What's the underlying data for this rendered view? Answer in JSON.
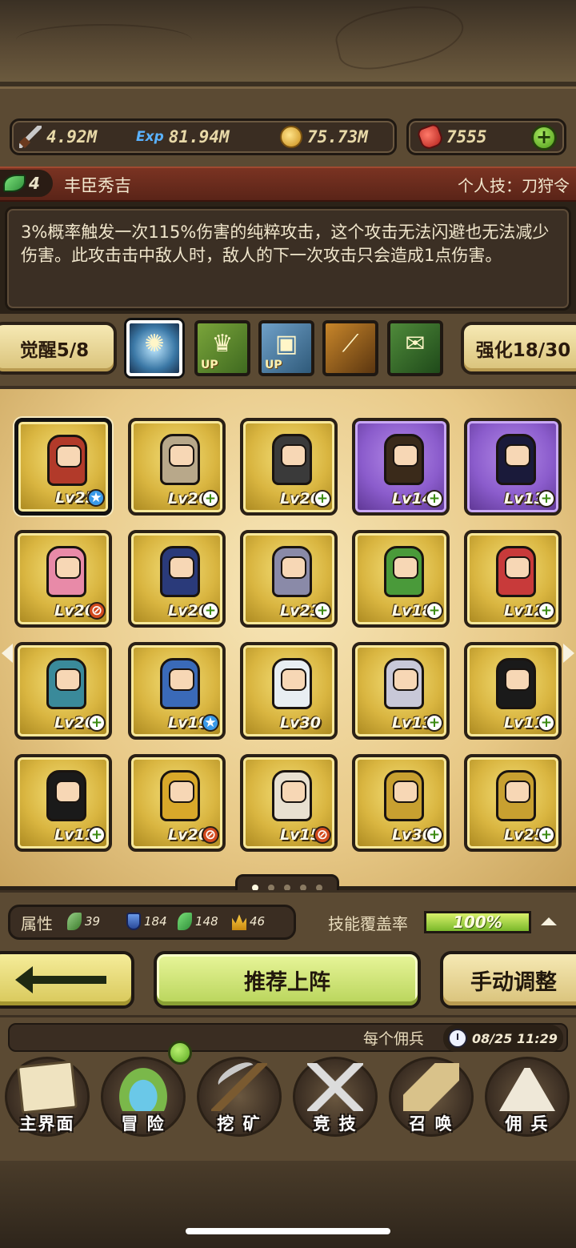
{
  "resources": {
    "attack": "4.92M",
    "exp_icon_text": "Exp",
    "exp": "81.94M",
    "gold": "75.73M",
    "gems": "7555",
    "plus_symbol": "+"
  },
  "hero": {
    "level": "4",
    "name": "丰臣秀吉",
    "skill": "个人技：刀狩令",
    "description": "3%概率触发一次115%伤害的纯粹攻击，这个攻击无法闪避也无法减少伤害。此攻击击中敌人时，敌人的下一次攻击只会造成1点伤害。"
  },
  "awaken": {
    "label": "觉醒5/8",
    "upgrade_label": "强化18/30",
    "up_text": "UP"
  },
  "heroes": [
    {
      "lv": "Lv25",
      "badge": "star",
      "sprite_color": "#b23a2a"
    },
    {
      "lv": "Lv26",
      "badge": "plus",
      "sprite_color": "#b8a88a"
    },
    {
      "lv": "Lv20",
      "badge": "plus",
      "sprite_color": "#3a3a3a"
    },
    {
      "lv": "Lv14",
      "badge": "plus",
      "sprite_color": "#3a2a1a",
      "purple": true
    },
    {
      "lv": "Lv13",
      "badge": "plus",
      "sprite_color": "#1a1a3a",
      "purple": true
    },
    {
      "lv": "Lv20",
      "badge": "no",
      "sprite_color": "#e88aa8"
    },
    {
      "lv": "Lv20",
      "badge": "plus",
      "sprite_color": "#2a3a7a"
    },
    {
      "lv": "Lv23",
      "badge": "plus",
      "sprite_color": "#8a8aa8"
    },
    {
      "lv": "Lv18",
      "badge": "plus",
      "sprite_color": "#4a9a3a"
    },
    {
      "lv": "Lv12",
      "badge": "plus",
      "sprite_color": "#c83a3a"
    },
    {
      "lv": "Lv20",
      "badge": "plus",
      "sprite_color": "#3a8a9a"
    },
    {
      "lv": "Lv19",
      "badge": "star",
      "sprite_color": "#3a6ab8"
    },
    {
      "lv": "Lv30",
      "badge": "",
      "sprite_color": "#e8eef2"
    },
    {
      "lv": "Lv13",
      "badge": "plus",
      "sprite_color": "#c8c8d8"
    },
    {
      "lv": "Lv11",
      "badge": "plus",
      "sprite_color": "#1a1a1a"
    },
    {
      "lv": "Lv11",
      "badge": "plus",
      "sprite_color": "#1a1a1a"
    },
    {
      "lv": "Lv20",
      "badge": "no",
      "sprite_color": "#d8a82a"
    },
    {
      "lv": "Lv15",
      "badge": "no",
      "sprite_color": "#e8e0d0"
    },
    {
      "lv": "Lv30",
      "badge": "plus",
      "sprite_color": "#c8a030"
    },
    {
      "lv": "Lv25",
      "badge": "plus",
      "sprite_color": "#c8a030"
    }
  ],
  "badge_symbols": {
    "plus": "+",
    "star": "★",
    "no": "⊘"
  },
  "attributes": {
    "label": "属性",
    "leaf": "39",
    "shield": "184",
    "gem": "148",
    "crown": "46",
    "coverage_label": "技能覆盖率",
    "coverage": "100%",
    "coverage_fraction": 1.0
  },
  "actions": {
    "recommend": "推荐上阵",
    "manual": "手动调整"
  },
  "notice": {
    "text": "每个佣兵",
    "time": "08/25 11:29"
  },
  "nav": [
    {
      "label": "主界面"
    },
    {
      "label": "冒 险"
    },
    {
      "label": "挖 矿"
    },
    {
      "label": "竞 技"
    },
    {
      "label": "召 唤"
    },
    {
      "label": "佣 兵"
    }
  ],
  "colors": {
    "panel_brown": "#5b4a33",
    "gold_card": "#d9b540",
    "purple_card": "#8b5ccc",
    "accent_green": "#b8d45a",
    "name_bar_red": "#7a3322"
  }
}
